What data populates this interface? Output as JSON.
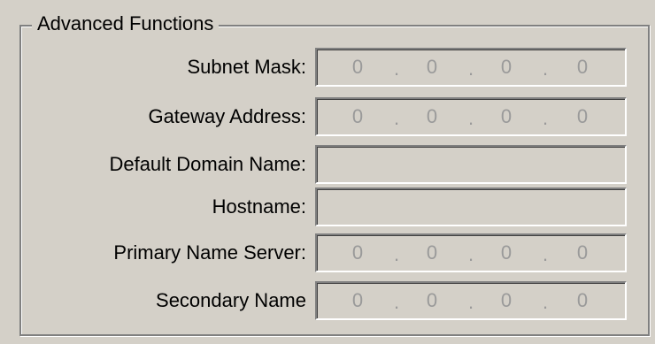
{
  "group": {
    "title": "Advanced Functions"
  },
  "fields": [
    {
      "label": "Subnet Mask:",
      "octets": [
        "0",
        "0",
        "0",
        "0"
      ],
      "separator": "."
    },
    {
      "label": "Gateway Address:",
      "octets": [
        "0",
        "0",
        "0",
        "0"
      ],
      "separator": "."
    },
    {
      "label": "Default Domain Name:",
      "value": ""
    },
    {
      "label": "Hostname:",
      "value": ""
    },
    {
      "label": "Primary Name Server:",
      "octets": [
        "0",
        "0",
        "0",
        "0"
      ],
      "separator": "."
    },
    {
      "label": "Secondary Name",
      "octets": [
        "0",
        "0",
        "0",
        "0"
      ],
      "separator": "."
    }
  ],
  "colors": {
    "background": "#d4d0c8",
    "disabled_text": "#9a9a9a"
  }
}
